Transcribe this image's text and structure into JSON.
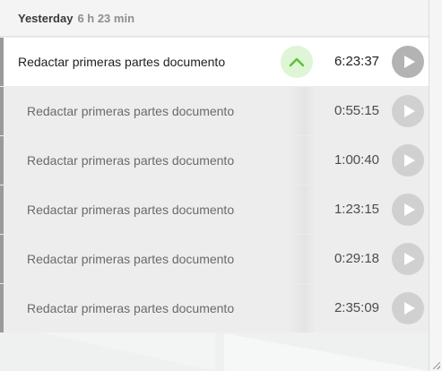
{
  "group": {
    "title": "Yesterday",
    "total": "6 h 23 min"
  },
  "group_entry": {
    "description": "Redactar primeras partes documento",
    "duration": "6:23:37",
    "collapse_icon": "chevron-up-icon",
    "play_icon": "play-icon"
  },
  "entries": [
    {
      "description": "Redactar primeras partes documento",
      "duration": "0:55:15"
    },
    {
      "description": "Redactar primeras partes documento",
      "duration": "1:00:40"
    },
    {
      "description": "Redactar primeras partes documento",
      "duration": "1:23:15"
    },
    {
      "description": "Redactar primeras partes documento",
      "duration": "0:29:18"
    },
    {
      "description": "Redactar primeras partes documento",
      "duration": "2:35:09"
    }
  ],
  "colors": {
    "accent_green": "#5fbf3c",
    "collapse_bg": "#def5d6",
    "play_bg": "#d0d0d0",
    "play_bg_active": "#b3b3b3"
  }
}
